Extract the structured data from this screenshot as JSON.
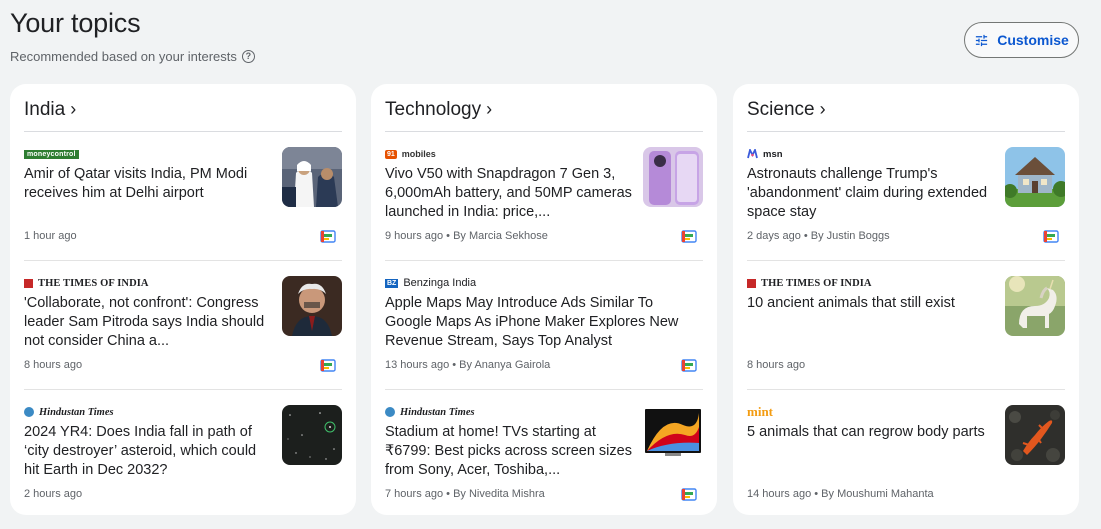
{
  "header": {
    "title": "Your topics",
    "subtitle": "Recommended based on your interests",
    "help_icon": "help-circle-icon"
  },
  "customise": {
    "label": "Customise",
    "icon": "tune-icon",
    "color": "#0b57d0"
  },
  "columns": [
    {
      "title": "India",
      "stories": [
        {
          "source": "moneycontrol",
          "headline": "Amir of Qatar visits India, PM Modi receives him at Delhi airport",
          "meta": "1 hour ago"
        },
        {
          "source": "THE TIMES OF INDIA",
          "headline": "'Collaborate, not confront': Congress leader Sam Pitroda says India should not consider China a...",
          "meta": "8 hours ago"
        },
        {
          "source": "Hindustan Times",
          "headline": "2024 YR4: Does India fall in path of ‘city destroyer’ asteroid, which could hit Earth in Dec 2032?",
          "meta": "2 hours ago"
        }
      ]
    },
    {
      "title": "Technology",
      "stories": [
        {
          "source": "mobiles",
          "source_prefix": "91",
          "headline": "Vivo V50 with Snapdragon 7 Gen 3, 6,000mAh battery, and 50MP cameras launched in India: price,...",
          "meta": "9 hours ago • By Marcia Sekhose"
        },
        {
          "source": "Benzinga India",
          "source_prefix": "BZ",
          "headline": "Apple Maps May Introduce Ads Similar To Google Maps As iPhone Maker Explores New Revenue Stream, Says Top Analyst",
          "meta": "13 hours ago • By Ananya Gairola"
        },
        {
          "source": "Hindustan Times",
          "headline": "Stadium at home! TVs starting at ₹6799: Best picks across screen sizes from Sony, Acer, Toshiba,...",
          "meta": "7 hours ago • By Nivedita Mishra"
        }
      ]
    },
    {
      "title": "Science",
      "stories": [
        {
          "source": "msn",
          "headline": "Astronauts challenge Trump's 'abandonment' claim during extended space stay",
          "meta": "2 days ago • By Justin Boggs"
        },
        {
          "source": "THE TIMES OF INDIA",
          "headline": "10 ancient animals that still exist",
          "meta": "8 hours ago"
        },
        {
          "source": "mint",
          "headline": "5 animals that can regrow body parts",
          "meta": "14 hours ago • By Moushumi Mahanta"
        }
      ]
    }
  ]
}
